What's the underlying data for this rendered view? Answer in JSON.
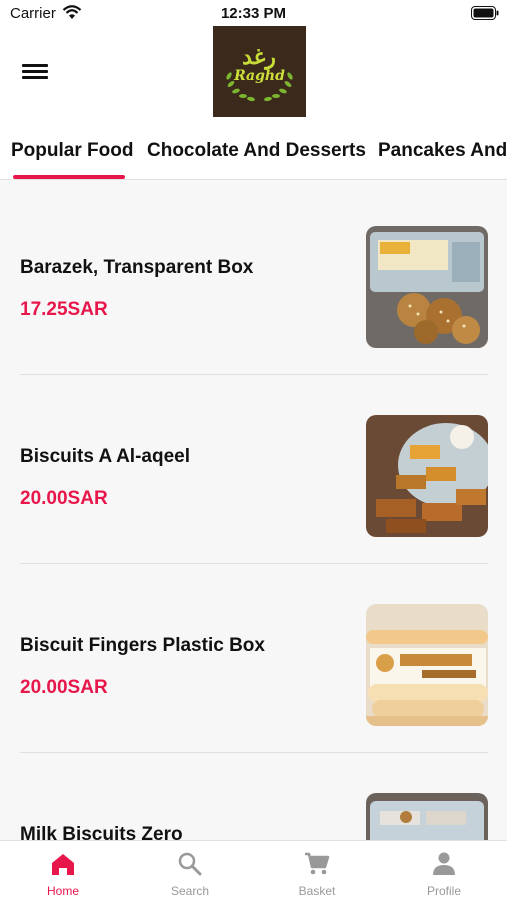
{
  "status_bar": {
    "carrier": "Carrier",
    "time": "12:33 PM"
  },
  "header": {
    "logo_text": "Raghd",
    "logo_arabic": "رغد"
  },
  "tabs": [
    {
      "label": "Popular Food",
      "active": true
    },
    {
      "label": "Chocolate And Desserts",
      "active": false
    },
    {
      "label": "Pancakes And",
      "active": false
    }
  ],
  "products": [
    {
      "name": "Barazek, Transparent Box",
      "price": "17.25SAR",
      "image_icon": "barazek-cookies-photo"
    },
    {
      "name": "Biscuits A Al-aqeel",
      "price": "20.00SAR",
      "image_icon": "biscuit-packs-photo"
    },
    {
      "name": "Biscuit Fingers Plastic Box",
      "price": "20.00SAR",
      "image_icon": "biscuit-fingers-photo"
    },
    {
      "name": "Milk Biscuits Zero",
      "price": "",
      "image_icon": "milk-biscuits-photo"
    }
  ],
  "bottom_nav": [
    {
      "label": "Home",
      "icon": "home-icon",
      "active": true
    },
    {
      "label": "Search",
      "icon": "search-icon",
      "active": false
    },
    {
      "label": "Basket",
      "icon": "cart-icon",
      "active": false
    },
    {
      "label": "Profile",
      "icon": "profile-icon",
      "active": false
    }
  ],
  "colors": {
    "accent": "#e8174b",
    "inactive": "#999999",
    "text": "#111111",
    "background": "#f7f7f7"
  }
}
